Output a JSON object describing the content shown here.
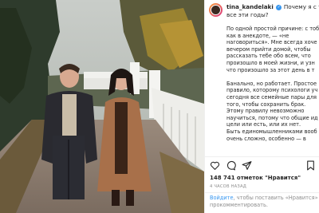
{
  "post": {
    "username": "tina_kandelaki",
    "caption_line1": "Почему я с тобой",
    "caption_line2": "все эти годы?",
    "body_text": "По одной простой причине: с тоб\nкак в анекдоте, — «не\nнаговориться». Мне всегда хоче\nвечером прийти домой, чтобы\nрассказать тебе обо всем, что\nпроизошло в моей жизни, и узн\nчто произошло за этот день в т\n\nБанально, но работает. Простое\nправило, которому психологи уч\nсегодня все семейные пары для\nтого, чтобы сохранить брак.\nЭтому правилу невозможно\nнаучиться, потому что общие ид\nцели или есть, или их нет.\nБыть единомышленниками вооб\nочень сложно, особенно — в",
    "likes_count": "148 741",
    "likes_word": "отметок",
    "likes_suffix": "\"Нравится\"",
    "time_ago": "4 ЧАСОВ НАЗАД",
    "footer_login": "Войдите",
    "footer_text_1": ", чтобы поставить «Нравится» или",
    "footer_text_2": "прокомментировать."
  },
  "icons": {
    "like": "heart-icon",
    "comment": "comment-icon",
    "share": "share-icon",
    "save": "bookmark-icon",
    "verified": "verified-badge-icon"
  },
  "colors": {
    "link": "#3897f0",
    "verified": "#3897f0",
    "muted": "#8e8e8e",
    "text": "#262626"
  }
}
